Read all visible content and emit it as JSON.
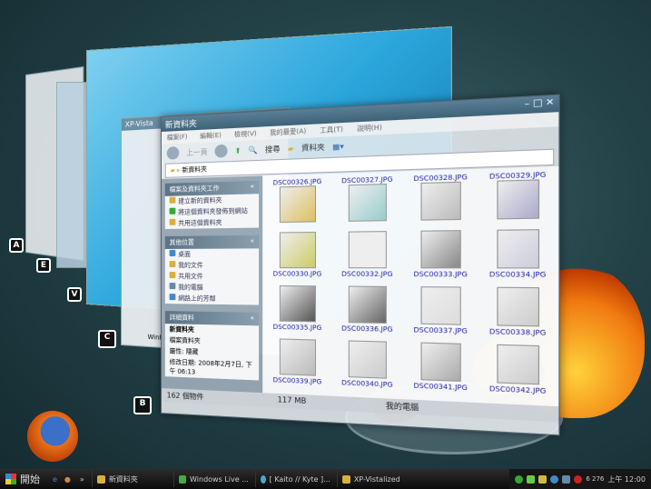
{
  "back_windows": {
    "xp_vista_title": "XP-Vista",
    "firefox_label": "WinRA"
  },
  "front": {
    "title": "新資料夾",
    "menu": [
      "檔案(F)",
      "編輯(E)",
      "檢視(V)",
      "我的最愛(A)",
      "工具(T)",
      "說明(H)"
    ],
    "toolbar": {
      "back": "上一頁",
      "search": "搜尋",
      "folders": "資料夾"
    },
    "address": "新資料夾",
    "tasks": {
      "title": "檔案及資料夾工作",
      "items": [
        "建立新的資料夾",
        "將這個資料夾發佈到網站",
        "共用這個資料夾"
      ]
    },
    "places": {
      "title": "其他位置",
      "items": [
        "桌面",
        "我的文件",
        "共用文件",
        "我的電腦",
        "網路上的芳鄰"
      ]
    },
    "details": {
      "title": "詳細資料",
      "name": "新資料夾",
      "type": "檔案資料夾",
      "attr": "屬性: 隱藏",
      "modified": "修改日期: 2008年2月7日, 下午 06:13"
    },
    "files": [
      "DSC00326.JPG",
      "DSC00327.JPG",
      "DSC00328.JPG",
      "DSC00329.JPG",
      "DSC00330.JPG",
      "DSC00332.JPG",
      "DSC00333.JPG",
      "DSC00334.JPG",
      "DSC00335.JPG",
      "DSC00336.JPG",
      "DSC00337.JPG",
      "DSC00338.JPG",
      "DSC00339.JPG",
      "DSC00340.JPG",
      "DSC00341.JPG",
      "DSC00342.JPG"
    ],
    "status": {
      "count": "162 個物件",
      "size": "117 MB",
      "location": "我的電腦"
    }
  },
  "taskbar": {
    "start": "開始",
    "buttons": [
      "新資料夾",
      "Windows Live ...",
      "[ Kaito // Kyte ]...",
      "XP-Vistalized"
    ],
    "tray_num": "6 276",
    "clock": "上午 12:00"
  }
}
